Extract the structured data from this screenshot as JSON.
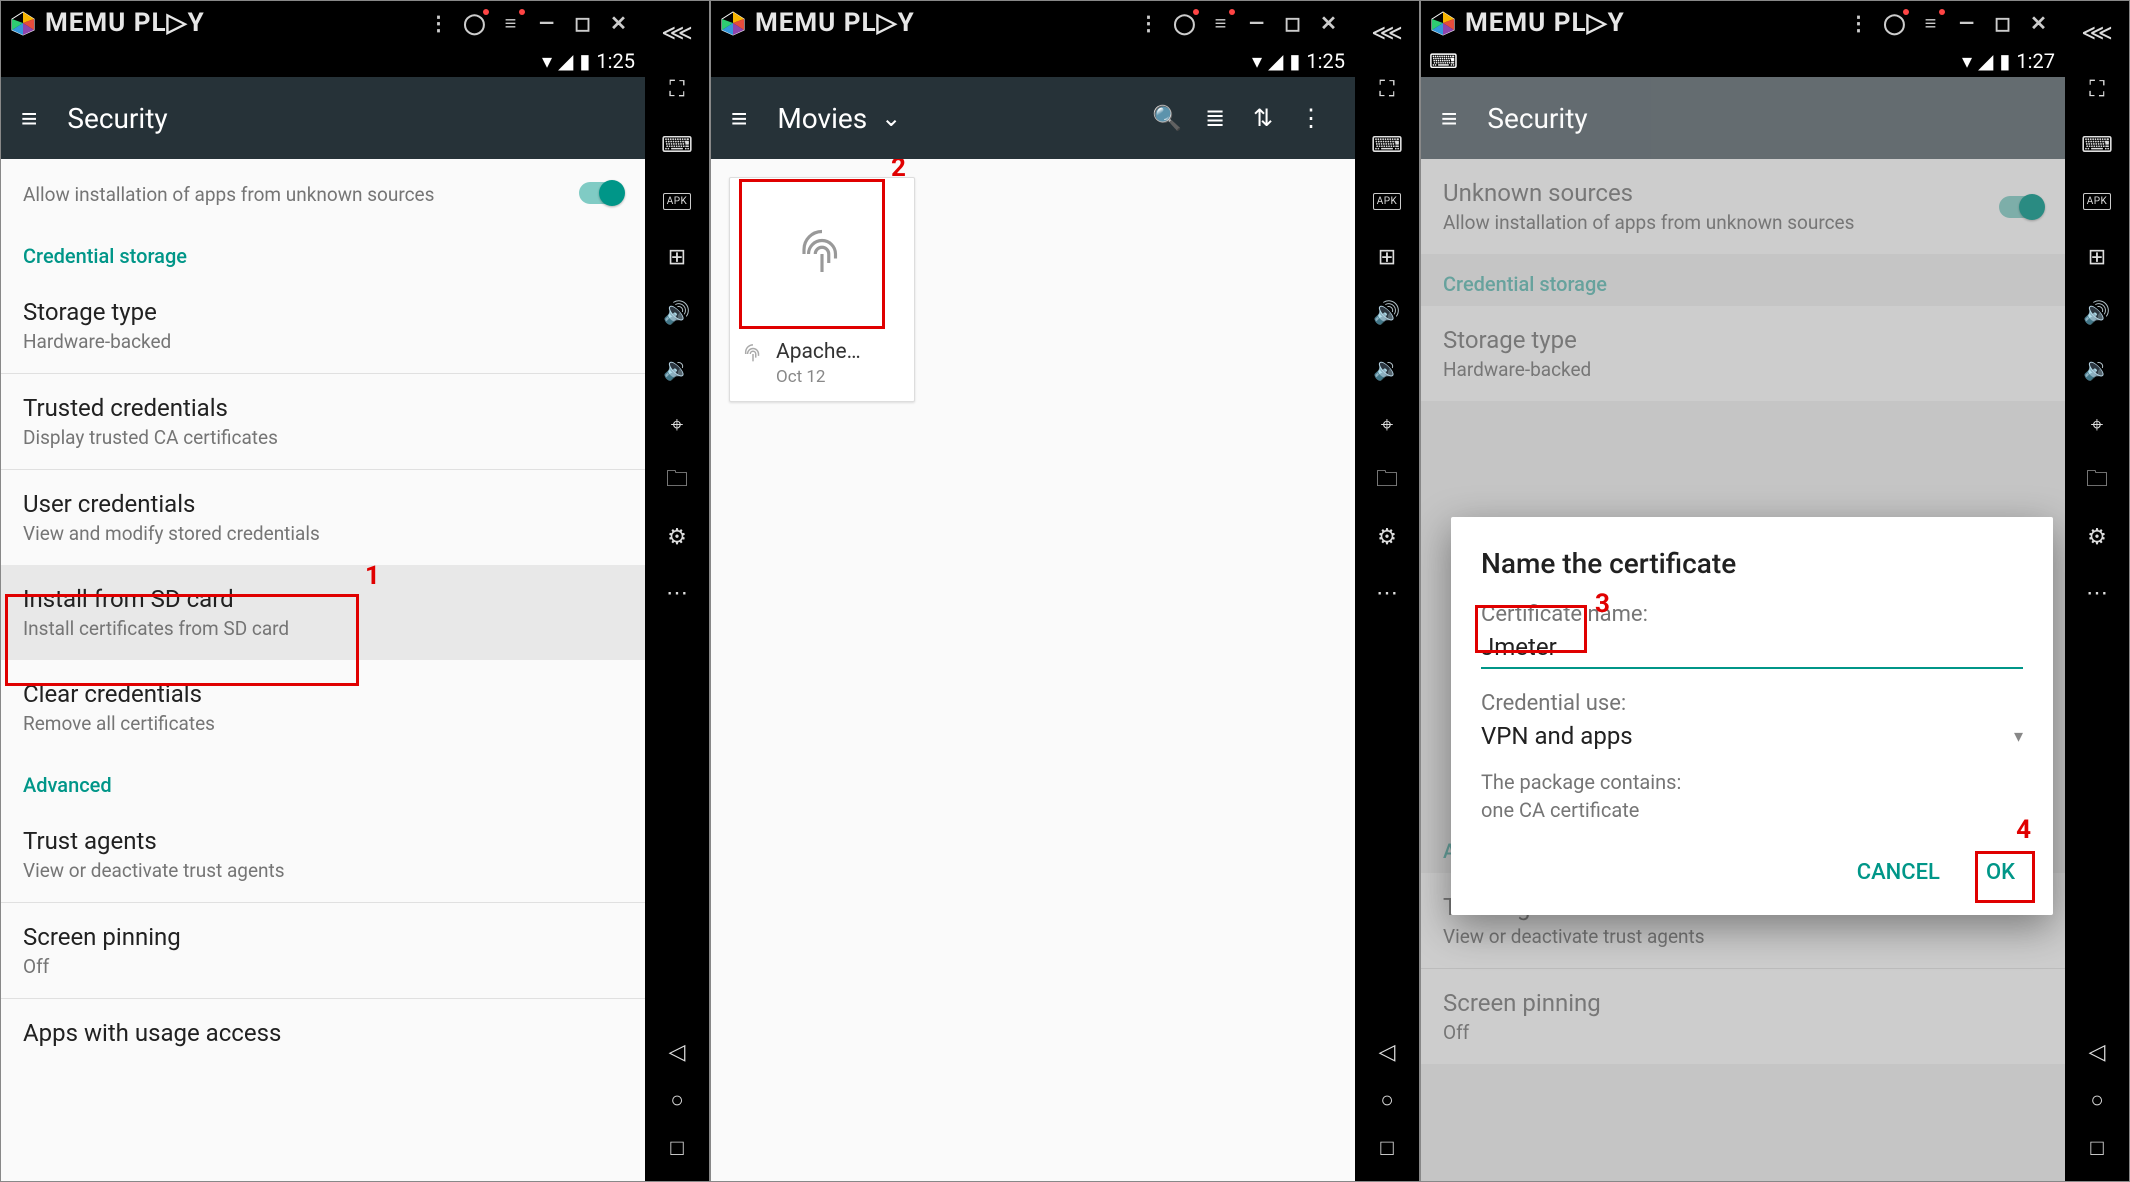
{
  "memu": {
    "brand": "MEMU PL▷Y"
  },
  "status": {
    "time_p1": "1:25",
    "time_p2": "1:25",
    "time_p3": "1:27"
  },
  "annotations": {
    "n1": "1",
    "n2": "2",
    "n3": "3",
    "n4": "4"
  },
  "panel1": {
    "appbar_title": "Security",
    "unknown_sources_sub": "Allow installation of apps from unknown sources",
    "section_credential": "Credential storage",
    "storage_type": {
      "title": "Storage type",
      "sub": "Hardware-backed"
    },
    "trusted": {
      "title": "Trusted credentials",
      "sub": "Display trusted CA certificates"
    },
    "user_creds": {
      "title": "User credentials",
      "sub": "View and modify stored credentials"
    },
    "install_sd": {
      "title": "Install from SD card",
      "sub": "Install certificates from SD card"
    },
    "clear": {
      "title": "Clear credentials",
      "sub": "Remove all certificates"
    },
    "section_advanced": "Advanced",
    "trust_agents": {
      "title": "Trust agents",
      "sub": "View or deactivate trust agents"
    },
    "screen_pin": {
      "title": "Screen pinning",
      "sub": "Off"
    },
    "usage": {
      "title": "Apps with usage access"
    }
  },
  "panel2": {
    "appbar_title": "Movies",
    "file": {
      "name": "Apache…",
      "date": "Oct 12"
    }
  },
  "panel3": {
    "appbar_title": "Security",
    "unknown_sources": {
      "title": "Unknown sources",
      "sub": "Allow installation of apps from unknown sources"
    },
    "section_credential": "Credential storage",
    "storage_type": {
      "title": "Storage type",
      "sub": "Hardware-backed"
    },
    "section_advanced": "Advanced",
    "trust_agents": {
      "title": "Trust agents",
      "sub": "View or deactivate trust agents"
    },
    "screen_pin": {
      "title": "Screen pinning",
      "sub": "Off"
    },
    "dialog": {
      "heading": "Name the certificate",
      "cert_name_label": "Certificate name:",
      "cert_name_value": "Jmeter",
      "cred_use_label": "Credential use:",
      "cred_use_value": "VPN and apps",
      "package_contains": "The package contains:",
      "package_line": "one CA certificate",
      "cancel": "CANCEL",
      "ok": "OK"
    }
  }
}
